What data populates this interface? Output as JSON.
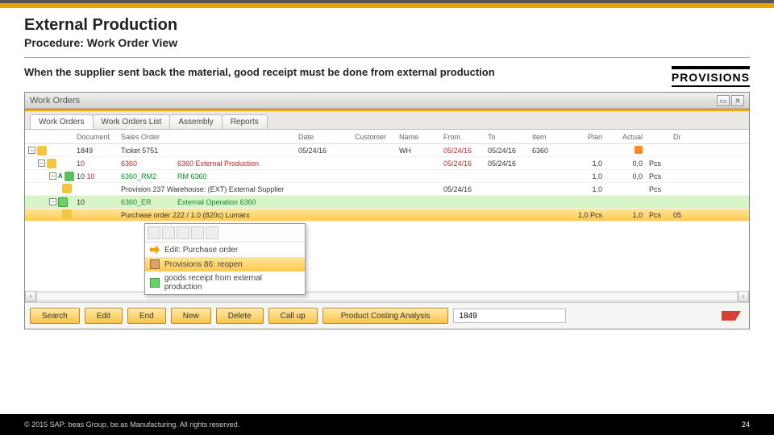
{
  "slide": {
    "title": "External Production",
    "subtitle": "Procedure: Work Order View",
    "description": "When the supplier sent back the material, good receipt must be done from external production",
    "side_label": "PROVISIONS"
  },
  "window": {
    "title": "Work Orders"
  },
  "tabs": [
    "Work Orders",
    "Work Orders List",
    "Assembly",
    "Reports"
  ],
  "columns": {
    "doc": "Document",
    "sales": "Sales Order",
    "date": "Date",
    "customer": "Customer",
    "name": "Name",
    "from": "From",
    "to": "To",
    "item": "Item",
    "plan": "Plan",
    "actual": "Actual",
    "dr": "Dr"
  },
  "rows": [
    {
      "level": 0,
      "icon": "cube-y",
      "doc": "1849",
      "sales": "Ticket 5751",
      "date": "05/24/16",
      "name": "WH",
      "from": "05/24/16",
      "to": "05/24/16",
      "item": "6360",
      "plan": "",
      "actual": "",
      "unit": "",
      "flag": true
    },
    {
      "level": 1,
      "icon": "cube-y",
      "doc": "10",
      "sales": "6360",
      "desc": "6360 External Production",
      "from": "05/24/16",
      "to": "05/24/16",
      "plan": "1,0",
      "actual": "0,0",
      "unit": "Pcs",
      "red_sales": true
    },
    {
      "level": 2,
      "icon": "cube-gr",
      "doc": "10",
      "doc_ext": "10",
      "sales": "6360_RM2",
      "desc": "RM 6360",
      "plan": "1,0",
      "actual": "0,0",
      "unit": "Pcs",
      "green_text": true
    },
    {
      "level": 3,
      "icon": "doc-y",
      "sales": "Provision 237  Warehouse: (EXT) External Supplier",
      "from": "05/24/16",
      "plan": "1,0",
      "unit": "Pcs"
    },
    {
      "level": 2,
      "icon": "truck",
      "doc": "10",
      "sales": "6360_ER",
      "desc": "External Operation 6360",
      "plan": "",
      "green_row": true,
      "green_text": true
    },
    {
      "level": 3,
      "icon": "cube-y",
      "sales": "Purchase order 222 / 1.0 (820c) Lumarx",
      "plan": "1,0 Pcs",
      "actual": "1,0",
      "unit": "Pcs",
      "dr": "05",
      "gold_row": true
    }
  ],
  "context_menu": {
    "items": [
      {
        "icon": "arrow",
        "label": "Edit: Purchase order"
      },
      {
        "icon": "box",
        "label": "Provisions 86: reopen",
        "hi": true
      },
      {
        "icon": "truck2",
        "label": "goods receipt from external production"
      }
    ]
  },
  "buttons": {
    "search": "Search",
    "edit": "Edit",
    "end": "End",
    "new": "New",
    "delete": "Delete",
    "callup": "Call up",
    "pca": "Product Costing Analysis",
    "doc_value": "1849"
  },
  "footer": {
    "copyright": "© 2015 SAP: beas Group, be.as Manufacturing.  All rights reserved.",
    "page": "24"
  }
}
